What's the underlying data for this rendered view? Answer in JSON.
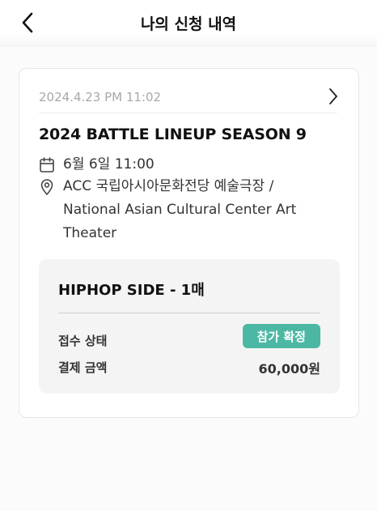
{
  "header": {
    "title": "나의 신청 내역"
  },
  "application": {
    "applied_at": "2024.4.23 PM 11:02",
    "event_title": "2024 BATTLE LINEUP SEASON 9",
    "date_time": "6월 6일 11:00",
    "venue": "ACC 국립아시아문화전당 예술극장 / National Asian Cultural Center Art Theater",
    "ticket": {
      "name": "HIPHOP SIDE - 1매",
      "status_label": "접수 상태",
      "status_value": "참가 확정",
      "payment_label": "결제 금액",
      "payment_value": "60,000원"
    }
  },
  "icons": {
    "back": "chevron-left-icon",
    "detail": "chevron-right-icon",
    "date": "calendar-icon",
    "venue": "location-pin-icon"
  },
  "colors": {
    "status_badge": "#4cb8a4",
    "muted_text": "#a8a8a8"
  }
}
